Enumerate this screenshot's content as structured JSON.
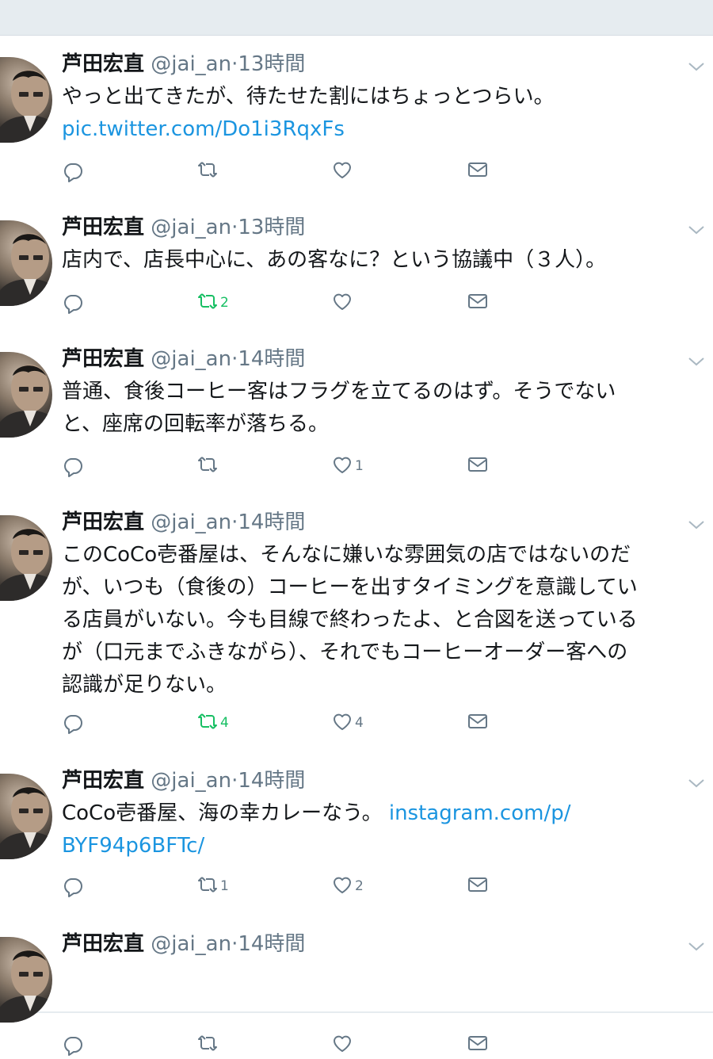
{
  "tweets": [
    {
      "name": "芦田宏直",
      "handle": "@jai_an",
      "dot": "·",
      "time": "13時間",
      "lines": [
        "やっと出てきたが、待たせた割にはちょっとつらい。"
      ],
      "link_line": "pic.twitter.com/Do1i3RqxFs",
      "retweets": "",
      "likes": "",
      "retweeted": false
    },
    {
      "name": "芦田宏直",
      "handle": "@jai_an",
      "dot": "·",
      "time": "13時間",
      "lines": [
        "店内で、店長中心に、あの客なに？という協議中（３人）。"
      ],
      "retweets": "2",
      "likes": "",
      "retweeted": true
    },
    {
      "name": "芦田宏直",
      "handle": "@jai_an",
      "dot": "·",
      "time": "14時間",
      "lines": [
        "普通、食後コーヒー客はフラグを立てるのはず。そうでない",
        "と、座席の回転率が落ちる。"
      ],
      "retweets": "",
      "likes": "1",
      "retweeted": false
    },
    {
      "name": "芦田宏直",
      "handle": "@jai_an",
      "dot": "·",
      "time": "14時間",
      "lines": [
        "このCoCo壱番屋は、そんなに嫌いな雰囲気の店ではないのだ",
        "が、いつも（食後の）コーヒーを出すタイミングを意識してい",
        "る店員がいない。今も目線で終わったよ、と合図を送っている",
        "が（口元までふきながら）、それでもコーヒーオーダー客への",
        "認識が足りない。"
      ],
      "retweets": "4",
      "likes": "4",
      "retweeted": true
    },
    {
      "name": "芦田宏直",
      "handle": "@jai_an",
      "dot": "·",
      "time": "14時間",
      "lines": [
        "CoCo壱番屋、海の幸カレーなう。"
      ],
      "inline_link": "instagram.com/p/",
      "link_line": "BYF94p6BFTc/",
      "retweets": "1",
      "likes": "2",
      "retweeted": false
    },
    {
      "name": "芦田宏直",
      "handle": "@jai_an",
      "dot": "·",
      "time": "14時間"
    }
  ]
}
